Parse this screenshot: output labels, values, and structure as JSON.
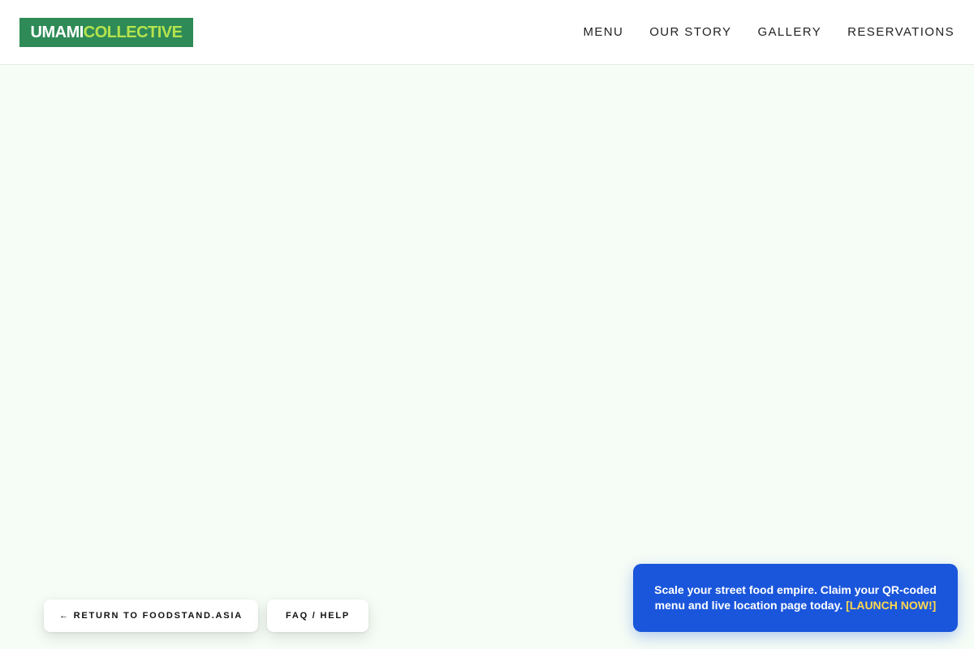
{
  "header": {
    "logo": {
      "part_1": "UMAMI",
      "part_2": "COLLECTIVE"
    },
    "nav": [
      {
        "label": "MENU"
      },
      {
        "label": "OUR STORY"
      },
      {
        "label": "GALLERY"
      },
      {
        "label": "RESERVATIONS"
      }
    ]
  },
  "footer_links": {
    "return_label": "← RETURN TO FOODSTAND.ASIA",
    "faq_label": "FAQ / HELP"
  },
  "promo": {
    "text": "Scale your street food empire. Claim your QR-coded menu and live location page today.",
    "cta": "[LAUNCH NOW!]"
  },
  "colors": {
    "logo_background": "#2e8b57",
    "logo_accent": "#b6e34e",
    "page_background": "#f6fdf6",
    "promo_background": "#1a56db",
    "promo_cta": "#ffd84d"
  }
}
